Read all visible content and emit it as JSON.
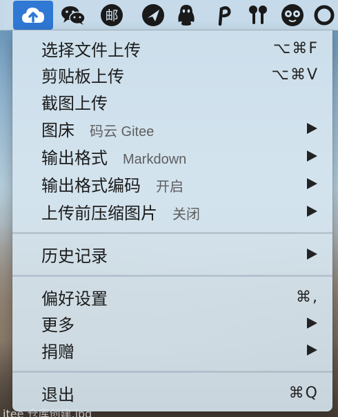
{
  "menubar": {
    "icons": [
      {
        "name": "picgo-cloud-icon",
        "active": true
      },
      {
        "name": "wechat-icon"
      },
      {
        "name": "postal-icon",
        "text": "邮"
      },
      {
        "name": "feishu-icon"
      },
      {
        "name": "qq-penguin-icon"
      },
      {
        "name": "paw-p-icon"
      },
      {
        "name": "airpods-icon"
      },
      {
        "name": "owl-icon"
      },
      {
        "name": "loading-ring-icon"
      }
    ]
  },
  "menu": {
    "sections": [
      [
        {
          "label": "选择文件上传",
          "shortcut": "⌥⌘F"
        },
        {
          "label": "剪贴板上传",
          "shortcut": "⌥⌘V"
        },
        {
          "label": "截图上传"
        },
        {
          "label": "图床",
          "sub": "码云 Gitee",
          "submenu": true
        },
        {
          "label": "输出格式",
          "sub": "Markdown",
          "submenu": true
        },
        {
          "label": "输出格式编码",
          "sub": "开启",
          "submenu": true
        },
        {
          "label": "上传前压缩图片",
          "sub": "关闭",
          "submenu": true
        }
      ],
      [
        {
          "label": "历史记录",
          "submenu": true
        }
      ],
      [
        {
          "label": "偏好设置",
          "shortcut": "⌘,"
        },
        {
          "label": "更多",
          "submenu": true
        },
        {
          "label": "捐赠",
          "submenu": true
        }
      ],
      [
        {
          "label": "退出",
          "shortcut": "⌘Q"
        }
      ]
    ]
  },
  "background": {
    "caption": "itee 仓库创建.jpg"
  },
  "colors": {
    "accent": "#2f78d4",
    "menu_bg": "#d6e6f0",
    "text": "#1b1b1b",
    "sub_text": "#5e5e5e"
  }
}
